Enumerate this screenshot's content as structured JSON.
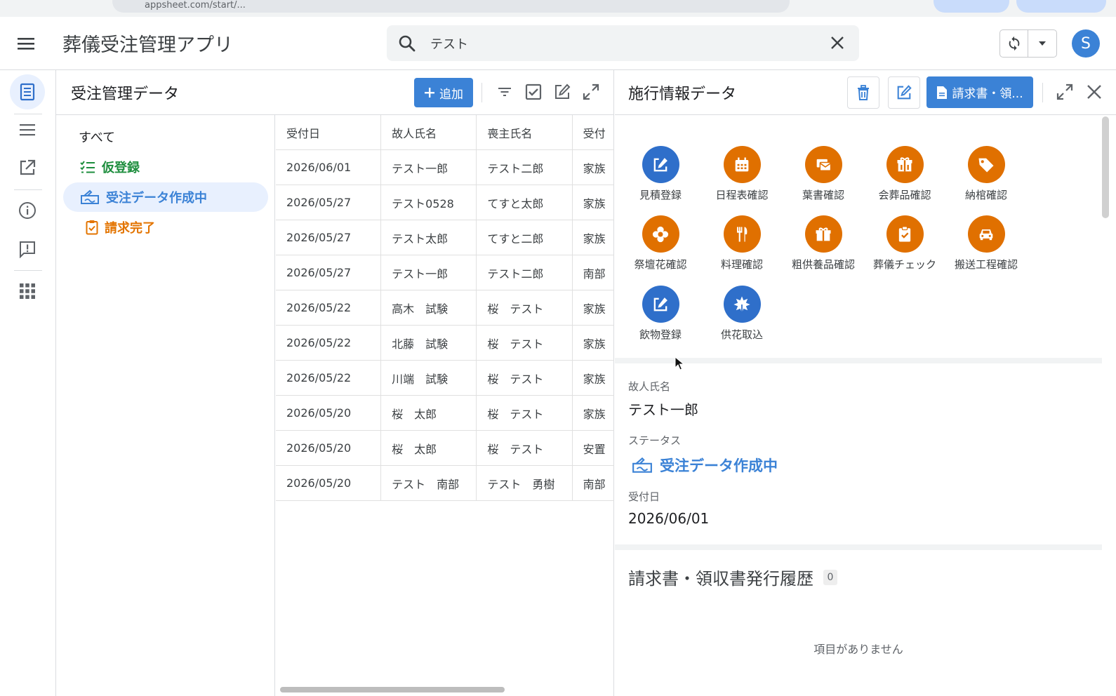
{
  "app": {
    "title": "葬儀受注管理アプリ"
  },
  "browser": {
    "url_fragment": "appsheet.com/start/..."
  },
  "search": {
    "value": "テスト"
  },
  "user": {
    "avatar_initial": "S"
  },
  "center": {
    "title": "受注管理データ",
    "add_label": "追加",
    "filters": {
      "all": "すべて",
      "temporary": "仮登録",
      "in_progress": "受注データ作成中",
      "billed": "請求完了"
    },
    "columns": [
      "受付日",
      "故人氏名",
      "喪主氏名",
      "受付"
    ],
    "rows": [
      {
        "date": "2026/06/01",
        "deceased": "テスト一郎",
        "chief": "テスト二郎",
        "extra": "家族"
      },
      {
        "date": "2026/05/27",
        "deceased": "テスト0528",
        "chief": "てすと太郎",
        "extra": "家族"
      },
      {
        "date": "2026/05/27",
        "deceased": "テスト太郎",
        "chief": "てすと二郎",
        "extra": "家族"
      },
      {
        "date": "2026/05/27",
        "deceased": "テスト一郎",
        "chief": "テスト二郎",
        "extra": "南部"
      },
      {
        "date": "2026/05/22",
        "deceased": "高木　試験",
        "chief": "桜　テスト",
        "extra": "家族"
      },
      {
        "date": "2026/05/22",
        "deceased": "北藤　試験",
        "chief": "桜　テスト",
        "extra": "家族"
      },
      {
        "date": "2026/05/22",
        "deceased": "川端　試験",
        "chief": "桜　テスト",
        "extra": "家族"
      },
      {
        "date": "2026/05/20",
        "deceased": "桜　太郎",
        "chief": "桜　テスト",
        "extra": "家族"
      },
      {
        "date": "2026/05/20",
        "deceased": "桜　太郎",
        "chief": "桜　テスト",
        "extra": "安置"
      },
      {
        "date": "2026/05/20",
        "deceased": "テスト　南部",
        "chief": "テスト　勇樹",
        "extra": "南部"
      }
    ]
  },
  "detail": {
    "title": "施行情報データ",
    "invoice_button": "請求書・領...",
    "actions": [
      {
        "label": "見積登録",
        "icon": "edit-note-icon",
        "color": "#2f6fca"
      },
      {
        "label": "日程表確認",
        "icon": "calendar-icon",
        "color": "#e07000"
      },
      {
        "label": "葉書確認",
        "icon": "postcard-icon",
        "color": "#e07000"
      },
      {
        "label": "会葬品確認",
        "icon": "gift-box-icon",
        "color": "#e07000"
      },
      {
        "label": "納棺確認",
        "icon": "tag-icon",
        "color": "#e07000"
      },
      {
        "label": "祭壇花確認",
        "icon": "flower-icon",
        "color": "#e07000"
      },
      {
        "label": "料理確認",
        "icon": "cutlery-icon",
        "color": "#e07000"
      },
      {
        "label": "粗供養品確認",
        "icon": "gift-icon",
        "color": "#e07000"
      },
      {
        "label": "葬儀チェック",
        "icon": "clipboard-check-icon",
        "color": "#e07000"
      },
      {
        "label": "搬送工程確認",
        "icon": "car-icon",
        "color": "#e07000"
      },
      {
        "label": "飲物登録",
        "icon": "edit-note-icon",
        "color": "#2f6fca"
      },
      {
        "label": "供花取込",
        "icon": "leaf-icon",
        "color": "#2f6fca"
      }
    ],
    "fields": {
      "deceased_label": "故人氏名",
      "deceased_value": "テスト一郎",
      "status_label": "ステータス",
      "status_value": "受注データ作成中",
      "date_label": "受付日",
      "date_value": "2026/06/01"
    },
    "history": {
      "title": "請求書・領収書発行履歴",
      "count": "0",
      "empty": "項目がありません"
    }
  }
}
